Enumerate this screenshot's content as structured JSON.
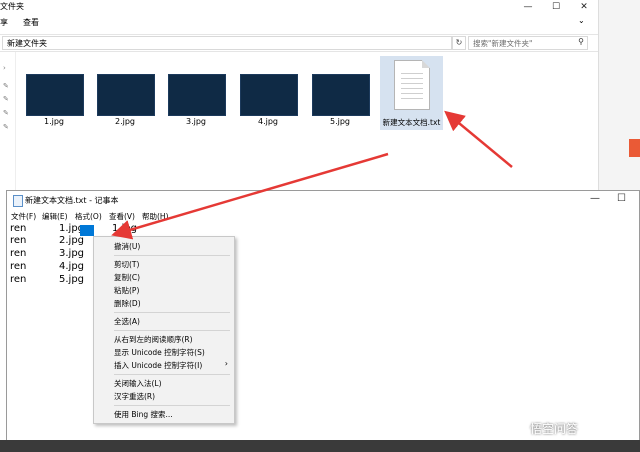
{
  "explorer": {
    "title": "文件夹",
    "ribbon": {
      "share": "享",
      "view": "查看"
    },
    "address": "新建文件夹",
    "search_placeholder": "搜索\"新建文件夹\"",
    "files": [
      {
        "label": "1.jpg"
      },
      {
        "label": "2.jpg"
      },
      {
        "label": "3.jpg"
      },
      {
        "label": "4.jpg"
      },
      {
        "label": "5.jpg"
      },
      {
        "label": "新建文本文档.txt"
      }
    ]
  },
  "notepad": {
    "title": "新建文本文档.txt - 记事本",
    "menu": [
      "文件(F)",
      "编辑(E)",
      "格式(O)",
      "查看(V)",
      "帮助(H)"
    ],
    "lines": [
      [
        "ren",
        "1.jpg",
        "1.jpg"
      ],
      [
        "ren",
        "2.jpg",
        ""
      ],
      [
        "ren",
        "3.jpg",
        ""
      ],
      [
        "ren",
        "4.jpg",
        ""
      ],
      [
        "ren",
        "5.jpg",
        ""
      ]
    ]
  },
  "context_menu": {
    "undo": "撤消(U)",
    "cut": "剪切(T)",
    "copy": "复制(C)",
    "paste": "粘贴(P)",
    "delete": "删除(D)",
    "select_all": "全选(A)",
    "rtl": "从右到左的阅读顺序(R)",
    "show_unicode": "显示 Unicode 控制字符(S)",
    "insert_unicode": "插入 Unicode 控制字符(I)",
    "close_ime": "关闭输入法(L)",
    "reconvert": "汉字重选(R)",
    "bing": "使用 Bing 搜索..."
  },
  "watermark": "悟空问答",
  "colors": {
    "arrow": "#e53935",
    "thumb": "#0f2a45",
    "selection": "#0078d7"
  }
}
